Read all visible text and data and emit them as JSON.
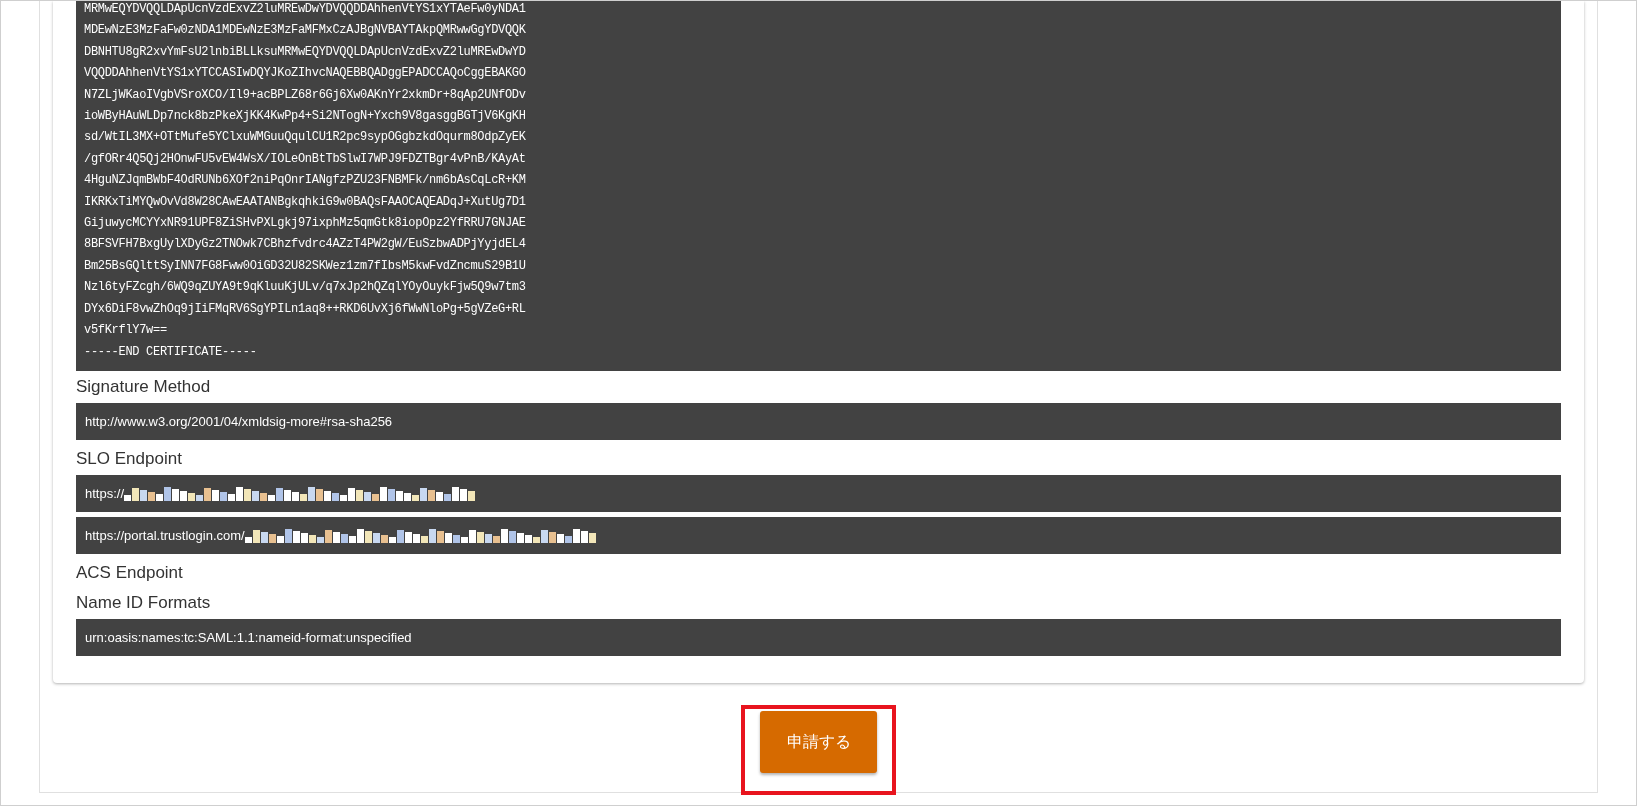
{
  "items": [
    {
      "kind": "certificate",
      "lines": [
        "MRMwEQYDVQQLDApUcnVzdExvZ2luMREwDwYDVQQDDAhhenVtYS1xYTAeFw0yNDA1",
        "MDEwNzE3MzFaFw0zNDA1MDEwNzE3MzFaMFMxCzAJBgNVBAYTAkpQMRwwGgYDVQQK",
        "DBNHTU8gR2xvYmFsU2lnbiBLLksuMRMwEQYDVQQLDApUcnVzdExvZ2luMREwDwYD",
        "VQQDDAhhenVtYS1xYTCCASIwDQYJKoZIhvcNAQEBBQADggEPADCCAQoCggEBAKGO",
        "N7ZLjWKaoIVgbVSroXCO/Il9+acBPLZ68r6Gj6Xw0AKnYr2xkmDr+8qAp2UNfODv",
        "ioWByHAuWLDp7nck8bzPkeXjKK4KwPp4+Si2NTogN+Yxch9V8gasggBGTjV6KgKH",
        "sd/WtIL3MX+OTtMufe5YClxuWMGuuQqulCU1R2pc9sypOGgbzkdOqurm8OdpZyEK",
        "/gfORr4Q5Qj2HOnwFU5vEW4WsX/IOLeOnBtTbSlwI7WPJ9FDZTBgr4vPnB/KAyAt",
        "4HguNZJqmBWbF4OdRUNb6XOf2niPqOnrIANgfzPZU23FNBMFk/nm6bAsCqLcR+KM",
        "IKRKxTiMYQwOvVd8W28CAwEAATANBgkqhkiG9w0BAQsFAAOCAQEADqJ+XutUg7D1",
        "GijuwycMCYYxNR91UPF8ZiSHvPXLgkj97ixphMz5qmGtk8iopOpz2YfRRU7GNJAE",
        "8BFSVFH7BxgUylXDyGz2TNOwk7CBhzfvdrc4AZzT4PW2gW/EuSzbwADPjYyjdEL4",
        "Bm25BsGQlttSyINN7FG8Fww0OiGD32U82SKWez1zm7fIbsM5kwFvdZncmuS29B1U",
        "Nzl6tyFZcgh/6WQ9qZUYA9t9qKluuKjULv/q7xJp2hQZqlYOyOuykFjw5Q9w7tm3",
        "DYx6DiF8vwZhOq9jIiFMqRV6SgYPILn1aq8++RKD6UvXj6fWwNloPg+5gVZeG+RL",
        "v5fKrflY7w==",
        "-----END CERTIFICATE-----"
      ]
    },
    {
      "kind": "label",
      "text": "Signature Method"
    },
    {
      "kind": "value",
      "text": "http://www.w3.org/2001/04/xmldsig-more#rsa-sha256",
      "redacted": false
    },
    {
      "kind": "label",
      "text": "SLO Endpoint"
    },
    {
      "kind": "value",
      "text": "https://",
      "redacted": true
    },
    {
      "kind": "value",
      "text": "https://portal.trustlogin.com/",
      "redacted": true
    },
    {
      "kind": "label",
      "text": "ACS Endpoint"
    },
    {
      "kind": "label",
      "text": "Name ID Formats"
    },
    {
      "kind": "value",
      "text": "urn:oasis:names:tc:SAML:1.1:nameid-format:unspecified",
      "redacted": false
    }
  ],
  "submit": {
    "label": "申請する",
    "highlighted": true
  }
}
